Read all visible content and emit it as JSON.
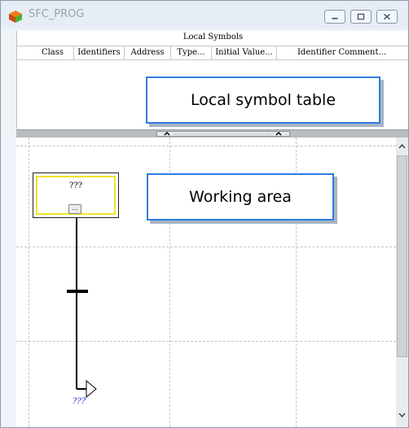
{
  "window": {
    "title": "SFC_PROG"
  },
  "symbols": {
    "title": "Local Symbols",
    "columns": [
      "Class",
      "Identifiers",
      "Address",
      "Type...",
      "Initial Value...",
      "Identifier Comment..."
    ]
  },
  "callouts": {
    "symbol_table": "Local symbol table",
    "working_area": "Working area"
  },
  "sfc": {
    "step_label": "???",
    "step_button": "...",
    "jump_label": "???"
  },
  "colors": {
    "callout_border": "#2e7de0",
    "step_highlight": "#f2e22a",
    "jump_label": "#1a35d8"
  }
}
